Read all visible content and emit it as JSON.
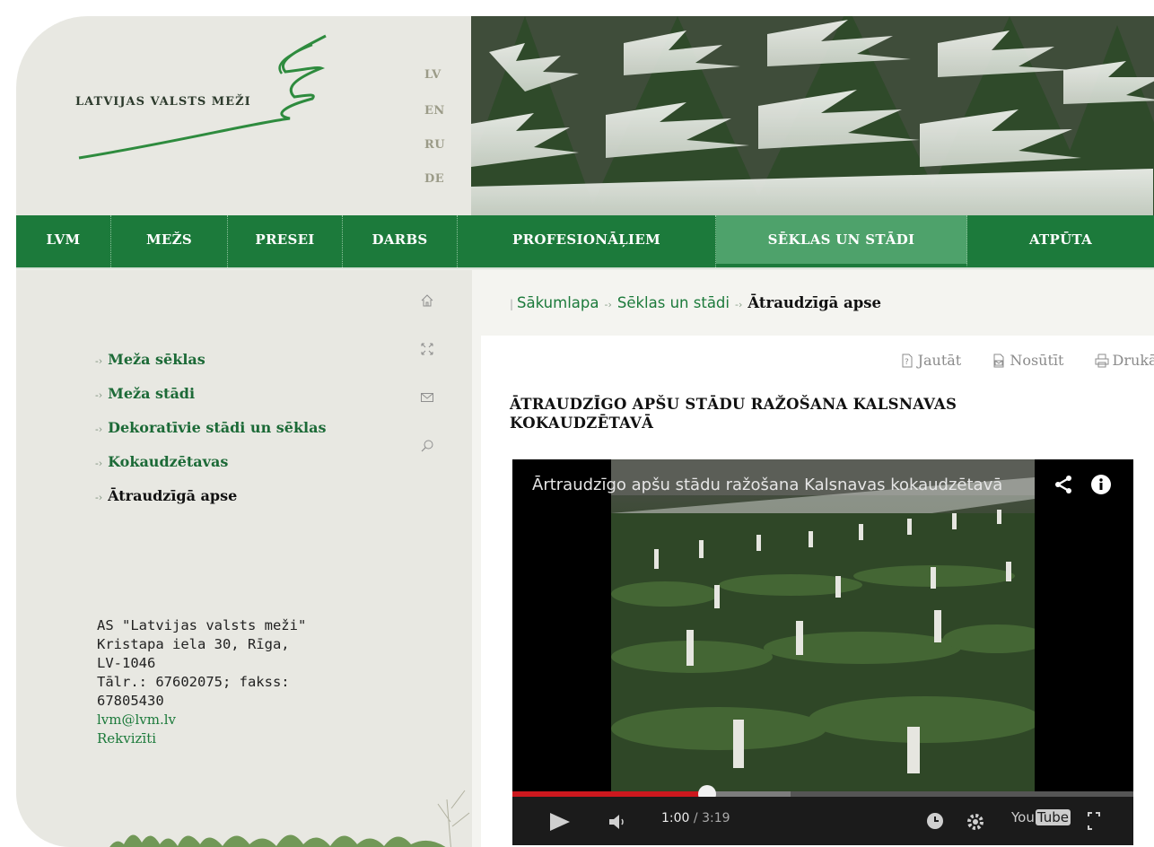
{
  "header": {
    "logo_text": "LATVIJAS VALSTS MEŽI",
    "languages": [
      "LV",
      "EN",
      "RU",
      "DE"
    ]
  },
  "nav": {
    "items": [
      {
        "label": "LVM"
      },
      {
        "label": "MEŽS"
      },
      {
        "label": "PRESEI"
      },
      {
        "label": "DARBS"
      },
      {
        "label": "PROFESIONĀĻIEM"
      },
      {
        "label": "SĒKLAS UN STĀDI"
      },
      {
        "label": "ATPŪTA"
      }
    ],
    "active": "SĒKLAS UN STĀDI"
  },
  "sidebar": {
    "icons": [
      "home-icon",
      "sitemap-icon",
      "mail-icon",
      "search-icon"
    ],
    "menu": [
      {
        "label": "Meža sēklas"
      },
      {
        "label": "Meža stādi"
      },
      {
        "label": "Dekoratīvie stādi un sēklas"
      },
      {
        "label": "Kokaudzētavas"
      },
      {
        "label": "Ātraudzīgā apse"
      }
    ],
    "current": "Ātraudzīgā apse",
    "address": {
      "company": "AS \"Latvijas valsts meži\"",
      "street": "Kristapa iela 30, Rīga,",
      "postcode": "LV-1046",
      "phone_line": "Tālr.: 67602075; fakss:",
      "fax": "67805430",
      "email": "lvm@lvm.lv",
      "details_link": "Rekvizīti"
    }
  },
  "breadcrumb": {
    "items": [
      "Sākumlapa",
      "Sēklas un stādi"
    ],
    "current": "Ātraudzīgā apse"
  },
  "article": {
    "tools": {
      "ask": "Jautāt",
      "send": "Nosūtīt",
      "print": "Drukāt"
    },
    "title_line1": "ĀTRAUDZĪGO APŠU STĀDU RAŽOŠANA KALSNAVAS",
    "title_line2": "KOKAUDZĒTAVĀ"
  },
  "video": {
    "title": "Ārtraudzīgo apšu stādu ražošana Kalsnavas kokaudzētavā",
    "current_time": "1:00",
    "duration": "3:19",
    "progress_fraction": 0.313,
    "buffered_fraction": 0.448,
    "youtube_label_a": "You",
    "youtube_label_b": "Tube",
    "accent_color": "#cc181e"
  },
  "colors": {
    "nav_green": "#1c7a3b",
    "nav_active": "#4ea26b",
    "link_green": "#1c6a37",
    "sidebar_bg": "#e8e8e2"
  }
}
